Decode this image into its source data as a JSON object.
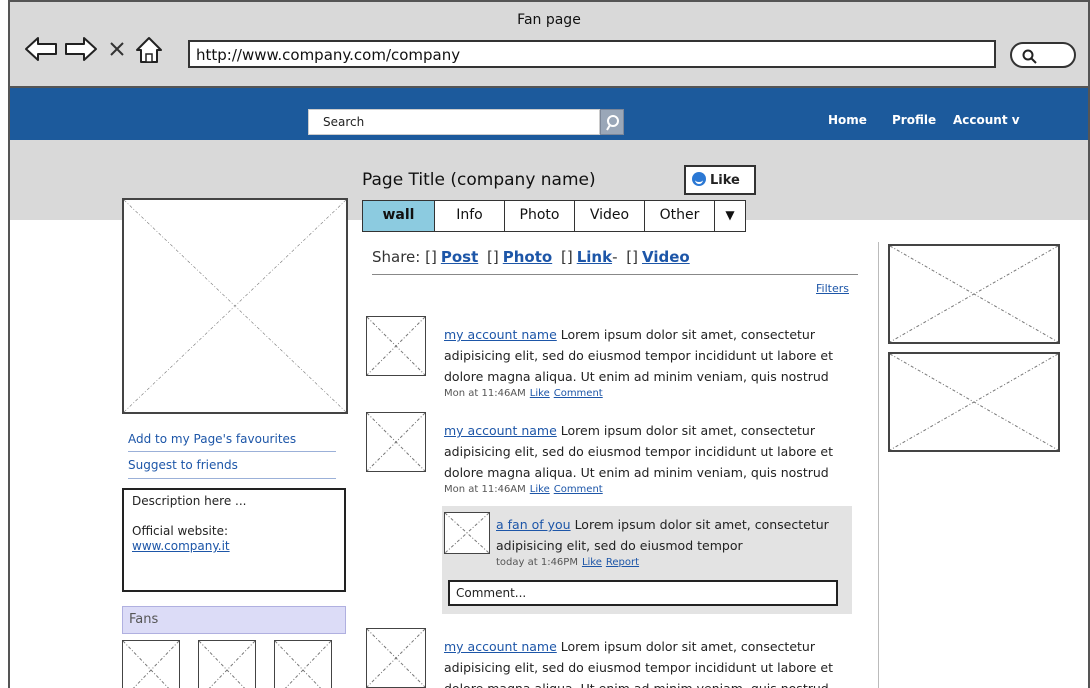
{
  "window": {
    "title": "Fan page"
  },
  "browser": {
    "url": "http://www.company.com/company",
    "icons": [
      "back-arrow-icon",
      "forward-arrow-icon",
      "close-icon",
      "home-icon",
      "search-icon"
    ]
  },
  "topbar": {
    "search_placeholder": "Search",
    "nav": [
      "Home",
      "Profile",
      "Account v"
    ],
    "color": "#1c5a9c"
  },
  "page": {
    "title": "Page Title (company name)",
    "like_label": "Like",
    "tabs": [
      "wall",
      "Info",
      "Photo",
      "Video",
      "Other"
    ],
    "tab_dropdown": "▼",
    "active_tab": "wall"
  },
  "left": {
    "links": [
      "Add to my Page's favourites",
      "Suggest to friends"
    ],
    "description": "Description here ...",
    "website_label": "Official website:",
    "website": "www.company.it",
    "fans_header": "Fans"
  },
  "share": {
    "label": "Share:",
    "bracket": "[]",
    "items": [
      "Post",
      "Photo",
      "Link",
      "Video"
    ],
    "link_suffix": "-"
  },
  "filters": "Filters",
  "posts": [
    {
      "author": "my account name",
      "text": " Lorem ipsum dolor sit amet, consectetur adipisicing elit, sed do eiusmod tempor incididunt ut labore et dolore magna aliqua. Ut enim ad minim veniam, quis nostrud",
      "time": "Mon at 11:46AM",
      "actions": [
        "Like",
        "Comment"
      ]
    },
    {
      "author": "my account name",
      "text": " Lorem ipsum dolor sit amet, consectetur adipisicing elit, sed do eiusmod tempor incididunt ut labore et dolore magna aliqua. Ut enim ad minim veniam, quis nostrud",
      "time": "Mon at 11:46AM",
      "actions": [
        "Like",
        "Comment"
      ]
    },
    {
      "author": "my account name",
      "text": " Lorem ipsum dolor sit amet, consectetur adipisicing elit, sed do eiusmod tempor incididunt ut labore et dolore magna aliqua. Ut enim ad minim veniam, quis nostrud"
    }
  ],
  "reply": {
    "author": "a fan of you",
    "text": " Lorem ipsum dolor sit amet, consectetur adipisicing elit, sed do eiusmod tempor",
    "time": "today at 1:46PM",
    "actions": [
      "Like",
      "Report"
    ],
    "comment_placeholder": "Comment..."
  }
}
